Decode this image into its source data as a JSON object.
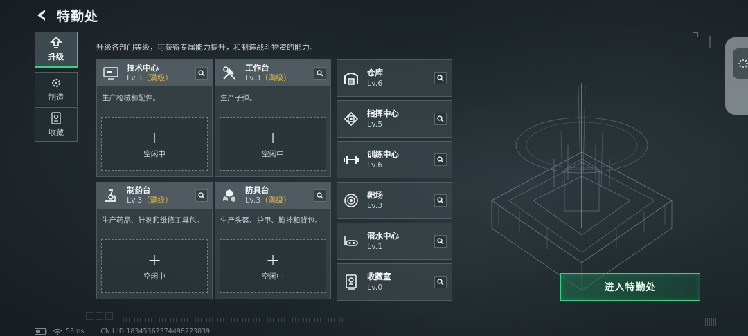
{
  "header": {
    "title": "特勤处",
    "description": "升级各部门等级，可获得专属能力提升，和制造战斗物资的能力。"
  },
  "tabs": [
    {
      "label": "升级",
      "icon": "upgrade-icon",
      "active": true
    },
    {
      "label": "制造",
      "icon": "gear-icon",
      "active": false
    },
    {
      "label": "收藏",
      "icon": "collection-icon",
      "active": false
    }
  ],
  "workshops": [
    {
      "name": "技术中心",
      "level": "Lv.3",
      "max": "（满级）",
      "desc": "生产枪械和配件。",
      "slot_plus": "+",
      "slot_label": "空闲中",
      "icon": "computer-icon"
    },
    {
      "name": "工作台",
      "level": "Lv.3",
      "max": "（满级）",
      "desc": "生产子弹。",
      "slot_plus": "+",
      "slot_label": "空闲中",
      "icon": "tools-icon"
    },
    {
      "name": "制药台",
      "level": "Lv.3",
      "max": "（满级）",
      "desc": "生产药品、针剂和维修工具包。",
      "slot_plus": "+",
      "slot_label": "空闲中",
      "icon": "microscope-icon"
    },
    {
      "name": "防具台",
      "level": "Lv.3",
      "max": "（满级）",
      "desc": "生产头盔、护甲、胸挂和背包。",
      "slot_plus": "+",
      "slot_label": "空闲中",
      "icon": "armor-icon"
    }
  ],
  "facilities": [
    {
      "name": "仓库",
      "level": "Lv.6",
      "icon": "warehouse-icon"
    },
    {
      "name": "指挥中心",
      "level": "Lv.5",
      "icon": "chip-icon"
    },
    {
      "name": "训练中心",
      "level": "Lv.6",
      "icon": "dumbbell-icon"
    },
    {
      "name": "靶场",
      "level": "Lv.3",
      "icon": "target-icon"
    },
    {
      "name": "潜水中心",
      "level": "Lv.1",
      "icon": "diving-icon"
    },
    {
      "name": "收藏室",
      "level": "Lv.0",
      "icon": "trophy-icon"
    }
  ],
  "enter_button": "进入特勤处",
  "footer": {
    "ping": "53ms",
    "uid": "CN UID:18345362374498223839"
  },
  "colors": {
    "accent_green": "#2fd487",
    "max_level_gold": "#e2b94f"
  }
}
